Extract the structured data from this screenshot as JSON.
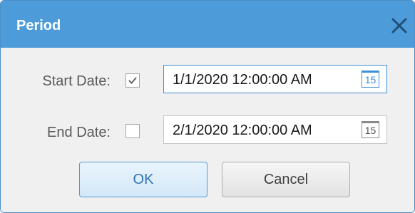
{
  "dialog": {
    "title": "Period",
    "close_icon": "close-icon"
  },
  "start": {
    "label": "Start Date:",
    "checked": true,
    "value": "1/1/2020 12:00:00 AM",
    "calendar_day": "15"
  },
  "end": {
    "label": "End Date:",
    "checked": false,
    "value": "2/1/2020 12:00:00 AM",
    "calendar_day": "15"
  },
  "buttons": {
    "ok": "OK",
    "cancel": "Cancel"
  },
  "colors": {
    "titlebar": "#4d9cd9",
    "accent": "#3e8fd6",
    "dialog_bg": "#f0f0f0"
  }
}
